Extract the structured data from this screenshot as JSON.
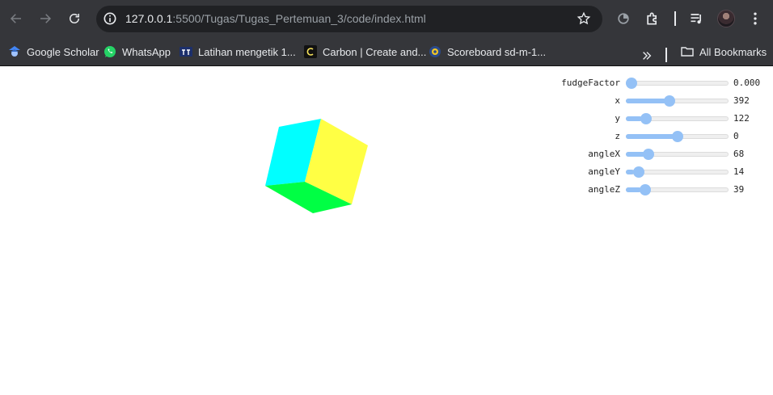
{
  "browser": {
    "url_host": "127.0.0.1",
    "url_rest": ":5500/Tugas/Tugas_Pertemuan_3/code/index.html",
    "icons": {
      "back": "arrow-left-icon",
      "forward": "arrow-right-icon",
      "reload": "reload-icon",
      "site_info": "info-icon",
      "bookmark_star": "star-icon",
      "extensions": "puzzle-icon",
      "media": "media-queue-icon",
      "menu": "more-vert-icon"
    }
  },
  "bookmarks": {
    "items": [
      {
        "label": "Google Scholar",
        "icon": "google-scholar-icon"
      },
      {
        "label": "WhatsApp",
        "icon": "whatsapp-icon"
      },
      {
        "label": "Latihan mengetik 1...",
        "icon": "typing-icon"
      },
      {
        "label": "Carbon | Create and...",
        "icon": "carbon-icon"
      },
      {
        "label": "Scoreboard sd-m-1...",
        "icon": "scoreboard-icon"
      }
    ],
    "all_bookmarks_label": "All Bookmarks"
  },
  "scene": {
    "cube_face_colors": {
      "left": "#00ffff",
      "right": "#ffff44",
      "bottom": "#00ff44"
    }
  },
  "controls": [
    {
      "label": "fudgeFactor",
      "value": "0.000",
      "level": 0.0
    },
    {
      "label": "x",
      "value": "392",
      "level": 0.42
    },
    {
      "label": "y",
      "value": "122",
      "level": 0.16
    },
    {
      "label": "z",
      "value": "0",
      "level": 0.5
    },
    {
      "label": "angleX",
      "value": "68",
      "level": 0.19
    },
    {
      "label": "angleY",
      "value": "14",
      "level": 0.08
    },
    {
      "label": "angleZ",
      "value": "39",
      "level": 0.15
    }
  ],
  "colors": {
    "toolbar_bg": "#35363a",
    "omnibox_bg": "#202124",
    "slider_accent": "#94c1f6"
  }
}
